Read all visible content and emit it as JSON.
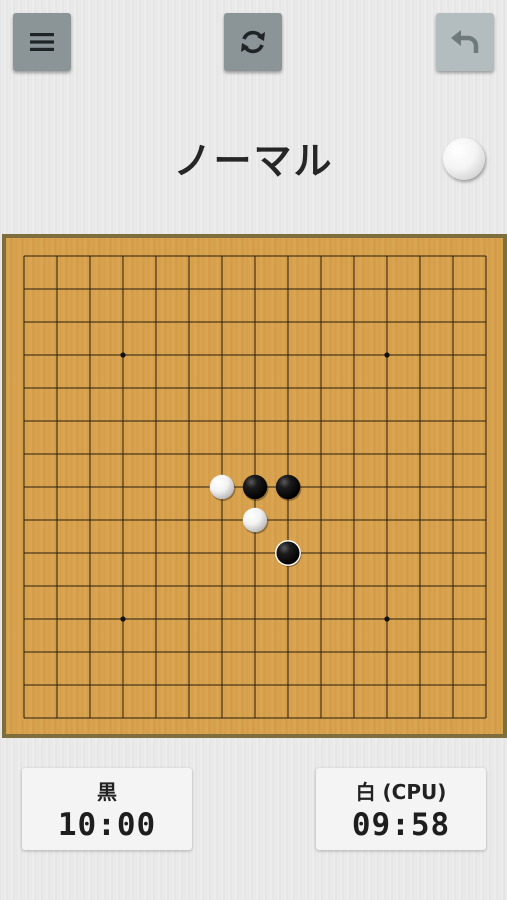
{
  "header": {
    "title": "ノーマル",
    "turn_stone_color": "white",
    "buttons": [
      {
        "name": "menu",
        "icon": "hamburger-icon",
        "enabled": true
      },
      {
        "name": "reset",
        "icon": "refresh-icon",
        "enabled": true
      },
      {
        "name": "undo",
        "icon": "undo-arrow-icon",
        "enabled": false
      }
    ]
  },
  "board": {
    "size": 15,
    "star_points": [
      [
        3,
        3
      ],
      [
        11,
        3
      ],
      [
        3,
        11
      ],
      [
        11,
        11
      ]
    ],
    "stones": [
      {
        "col": 6,
        "row": 7,
        "color": "white"
      },
      {
        "col": 7,
        "row": 7,
        "color": "black"
      },
      {
        "col": 8,
        "row": 7,
        "color": "black"
      },
      {
        "col": 7,
        "row": 8,
        "color": "white"
      },
      {
        "col": 8,
        "row": 9,
        "color": "black",
        "last_move": true
      }
    ]
  },
  "clocks": {
    "black": {
      "label": "黒",
      "time": "10:00"
    },
    "white": {
      "label": "白 (CPU)",
      "time": "09:58"
    }
  },
  "colors": {
    "button": "#8b9597",
    "button_disabled": "#b3bcbe",
    "board_wood": "#d6a04c",
    "board_frame": "#7e6e3c",
    "grid_line": "#2a1e0e"
  }
}
